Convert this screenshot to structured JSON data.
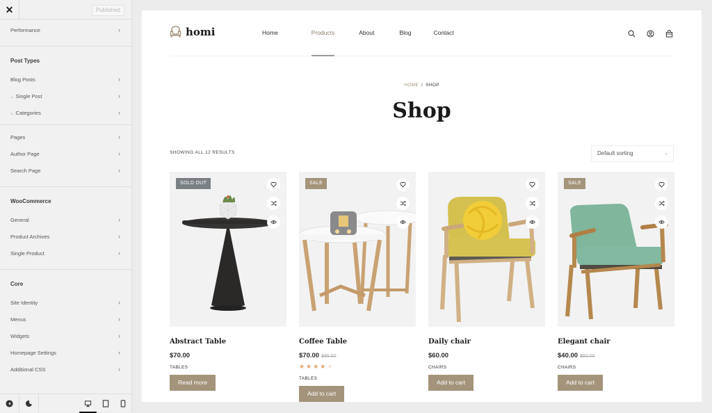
{
  "sidebar": {
    "close_icon": "✕",
    "published_label": "Published",
    "sections": [
      {
        "heading": null,
        "items": [
          {
            "label": "Performance",
            "child": false
          }
        ]
      },
      {
        "heading": "Post Types",
        "items": [
          {
            "label": "Blog Posts",
            "child": false
          },
          {
            "label": "Single Post",
            "child": true
          },
          {
            "label": "Categories",
            "child": true
          }
        ]
      },
      {
        "heading": null,
        "items": [
          {
            "label": "Pages",
            "child": false
          },
          {
            "label": "Author Page",
            "child": false
          },
          {
            "label": "Search Page",
            "child": false
          }
        ]
      },
      {
        "heading": "WooCommerce",
        "items": [
          {
            "label": "General",
            "child": false
          },
          {
            "label": "Product Archives",
            "child": false
          },
          {
            "label": "Single Product",
            "child": false
          }
        ]
      },
      {
        "heading": "Core",
        "items": [
          {
            "label": "Site Identity",
            "child": false
          },
          {
            "label": "Menus",
            "child": false
          },
          {
            "label": "Widgets",
            "child": false
          },
          {
            "label": "Homepage Settings",
            "child": false
          },
          {
            "label": "Additional CSS",
            "child": false
          }
        ]
      }
    ],
    "bottom": {
      "hide_controls_icon": "◀",
      "dark_mode_icon": "☾",
      "devices": [
        {
          "name": "desktop-icon",
          "active": true
        },
        {
          "name": "tablet-icon",
          "active": false
        },
        {
          "name": "mobile-icon",
          "active": false
        }
      ]
    }
  },
  "site": {
    "logo_text": "homi",
    "nav": [
      {
        "label": "Home",
        "active": false
      },
      {
        "label": "Products",
        "active": true
      },
      {
        "label": "About",
        "active": false
      },
      {
        "label": "Blog",
        "active": false
      },
      {
        "label": "Contact",
        "active": false
      }
    ],
    "breadcrumb": {
      "home": "HOME",
      "separator": "/",
      "current": "SHOP"
    },
    "title": "Shop",
    "results_text": "SHOWING ALL 12 RESULTS",
    "sorting": {
      "selected": "Default sorting"
    },
    "colors": {
      "accent": "#a3947b",
      "sold_out": "#7b8084",
      "star": "#e0a56b"
    }
  },
  "products": [
    {
      "name": "Abstract Table",
      "price": "$70.00",
      "old_price": null,
      "badge": "SOLD OUT",
      "badge_type": "sold",
      "rating": null,
      "category": "TABLES",
      "button": "Read more",
      "image": "abstract-table"
    },
    {
      "name": "Coffee Table",
      "price": "$70.00",
      "old_price": "$85.00",
      "badge": "SALE",
      "badge_type": "sale",
      "rating": 4,
      "category": "TABLES",
      "button": "Add to cart",
      "image": "coffee-table"
    },
    {
      "name": "Daily chair",
      "price": "$60.00",
      "old_price": null,
      "badge": null,
      "badge_type": null,
      "rating": null,
      "category": "CHAIRS",
      "button": "Add to cart",
      "image": "yellow-chair"
    },
    {
      "name": "Elegant chair",
      "price": "$40.00",
      "old_price": "$50.00",
      "badge": "SALE",
      "badge_type": "sale",
      "rating": null,
      "category": "CHAIRS",
      "button": "Add to cart",
      "image": "green-chair"
    }
  ]
}
